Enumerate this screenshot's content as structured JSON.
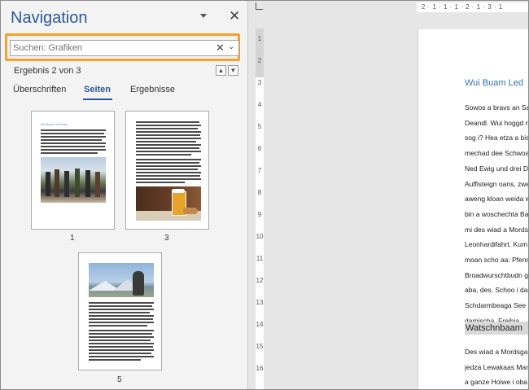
{
  "navigation": {
    "title": "Navigation",
    "search": {
      "value": "",
      "placeholder": "Suchen: Grafiken"
    },
    "result": "Ergebnis 2 von 3",
    "tabs": [
      {
        "label": "Überschriften",
        "active": false
      },
      {
        "label": "Seiten",
        "active": true
      },
      {
        "label": "Ergebnisse",
        "active": false
      }
    ],
    "thumbnails": [
      {
        "page": "1",
        "title": "Wui Buam Ledl Sepp"
      },
      {
        "page": "3"
      },
      {
        "page": "5"
      }
    ]
  },
  "ruler": {
    "vertical": [
      "1",
      "2",
      "3",
      "4",
      "5",
      "6",
      "7",
      "8",
      "9",
      "10",
      "11",
      "12",
      "13",
      "14",
      "15",
      "16"
    ],
    "horizontal": "· 2 · 1 · 1 · 1 · 2 · 1 · 3 · 1"
  },
  "document": {
    "heading1": "Wui Buam Led",
    "paragraph1": [
      "Sowos a bravs an Sa",
      "Deandl. Wui hoggd n",
      "sog i? Hea etza a biss",
      "mechad dee Schwoa",
      "Ned Ewig und drei D",
      "Auffisteign oans, zwe",
      "aweng kloan weida w",
      "bin a woschechta Ba",
      "mi des wiad a Mords",
      "Leonhardifahrt. Kum",
      "moan scho aa: Pfenn",
      "Broadwurschtbudn g",
      "aba, des. Schoo i daz",
      "Schdarmbeaga See s",
      "damischa, Freibia."
    ],
    "heading2": "Watschnbaam",
    "paragraph2": [
      "Des wiad a Mordsga",
      "jedza Lewakaas Mare",
      "a ganze Hoiwe i oba"
    ]
  },
  "colors": {
    "accent": "#2b579a",
    "highlight": "#f7a12a",
    "heading": "#2e74b5"
  }
}
